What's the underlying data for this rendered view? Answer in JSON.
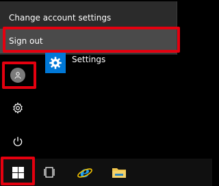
{
  "account_menu": {
    "change_settings_label": "Change account settings",
    "sign_out_label": "Sign out"
  },
  "tiles": {
    "settings_label": "Settings",
    "settings_icon": "gear-icon"
  },
  "rail": {
    "user_icon": "user-icon",
    "settings_icon": "gear-icon",
    "power_icon": "power-icon"
  },
  "taskbar": {
    "start_icon": "windows-logo-icon",
    "task_view_icon": "task-view-icon",
    "browser_icon": "internet-explorer-icon",
    "explorer_icon": "file-explorer-icon"
  },
  "colors": {
    "highlight": "#e5000f",
    "accent": "#0078d7"
  }
}
